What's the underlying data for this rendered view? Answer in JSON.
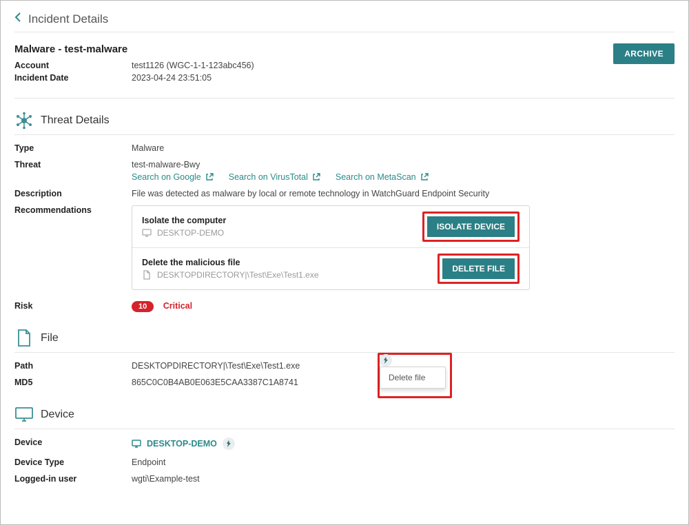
{
  "breadcrumb": {
    "title": "Incident Details"
  },
  "header": {
    "title": "Malware - test-malware",
    "account_label": "Account",
    "account_value": "test1126 (WGC-1-1-123abc456)",
    "date_label": "Incident Date",
    "date_value": "2023-04-24 23:51:05",
    "archive_label": "ARCHIVE"
  },
  "threat": {
    "section_title": "Threat Details",
    "type_label": "Type",
    "type_value": "Malware",
    "threat_label": "Threat",
    "threat_value": "test-malware-Bwy",
    "links": {
      "google": "Search on Google",
      "virustotal": "Search on VirusTotal",
      "metascan": "Search on MetaScan"
    },
    "desc_label": "Description",
    "desc_value": "File was detected as malware by local or remote technology in WatchGuard Endpoint Security",
    "rec_label": "Recommendations",
    "recs": [
      {
        "title": "Isolate the computer",
        "sub": "DESKTOP-DEMO",
        "button": "ISOLATE DEVICE",
        "icon": "monitor"
      },
      {
        "title": "Delete the malicious file",
        "sub": "DESKTOPDIRECTORY|\\Test\\Exe\\Test1.exe",
        "button": "DELETE FILE",
        "icon": "file"
      }
    ],
    "risk_label": "Risk",
    "risk_score": "10",
    "risk_level": "Critical"
  },
  "file": {
    "section_title": "File",
    "path_label": "Path",
    "path_value": "DESKTOPDIRECTORY|\\Test\\Exe\\Test1.exe",
    "md5_label": "MD5",
    "md5_value": "865C0C0B4AB0E063E5CAA3387C1A8741",
    "popover_action": "Delete file"
  },
  "device": {
    "section_title": "Device",
    "device_label": "Device",
    "device_value": "DESKTOP-DEMO",
    "type_label": "Device Type",
    "type_value": "Endpoint",
    "user_label": "Logged-in user",
    "user_value": "wgti\\Example-test"
  }
}
